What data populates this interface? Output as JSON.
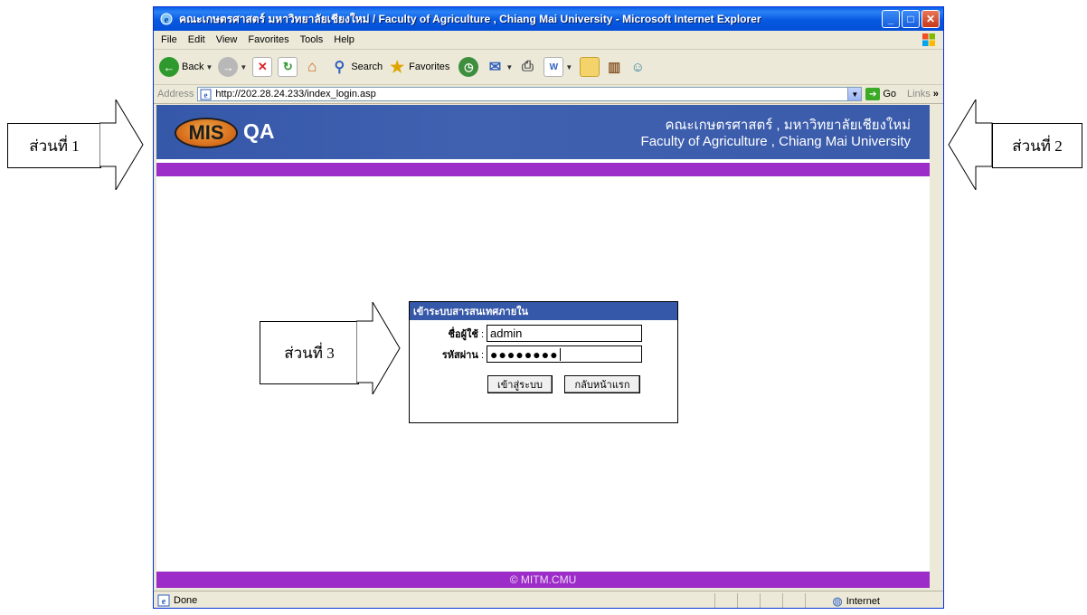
{
  "callouts": [
    {
      "label": "ส่วนที่ 1"
    },
    {
      "label": "ส่วนที่ 2"
    },
    {
      "label": "ส่วนที่ 3"
    }
  ],
  "window": {
    "title": "คณะเกษตรศาสตร์ มหาวิทยาลัยเชียงใหม่ / Faculty of Agriculture , Chiang Mai University   - Microsoft Internet Explorer",
    "controls": [
      "minimize",
      "maximize",
      "close"
    ]
  },
  "menu": [
    "File",
    "Edit",
    "View",
    "Favorites",
    "Tools",
    "Help"
  ],
  "toolbar": {
    "back_label": "Back",
    "search_label": "Search",
    "favorites_label": "Favorites"
  },
  "address": {
    "label": "Address",
    "url": "http://202.28.24.233/index_login.asp",
    "go_label": "Go",
    "links_label": "Links"
  },
  "banner": {
    "logo_mis": "MIS",
    "logo_qa": "QA",
    "title_th": "คณะเกษตรศาสตร์ , มหาวิทยาลัยเชียงใหม่",
    "title_en": "Faculty of Agriculture , Chiang Mai University"
  },
  "login": {
    "heading": "เข้าระบบสารสนเทศภายใน",
    "username_label": "ชื่อผู้ใช้",
    "username_value": "admin",
    "password_label": "รหัสผ่าน",
    "password_value": "●●●●●●●●",
    "submit_label": "เข้าสู่ระบบ",
    "home_label": "กลับหน้าแรก"
  },
  "footer": {
    "text": "© MITM.CMU"
  },
  "status": {
    "text": "Done",
    "zone": "Internet"
  },
  "colors": {
    "banner_blue": "#3658A8",
    "purple_bar": "#9C2DC8",
    "xp_title_blue": "#0758E0"
  }
}
